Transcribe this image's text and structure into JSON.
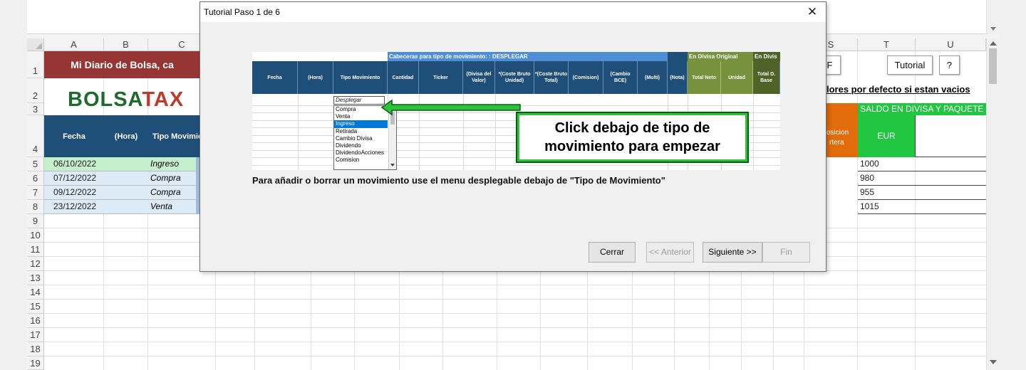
{
  "dialog": {
    "title": "Tutorial Paso 1 de 6",
    "close_glyph": "✕",
    "instruction": "Para añadir o borrar un movimiento use el menu desplegable debajo de \"Tipo de Movimiento\"",
    "callout": "Click debajo de tipo de movimiento para empezar",
    "buttons": {
      "cerrar": "Cerrar",
      "anterior": "<< Anterior",
      "siguiente": "Siguiente >>",
      "fin": "Fin"
    },
    "screenshot": {
      "band_desplegar": "Cabeceras para tipo de movimiento: : DESPLEGAR",
      "band_divisa": "En Divisa Original",
      "band_divis": "En Divis",
      "headers": [
        "Fecha",
        "(Hora)",
        "Tipo Movimiento",
        "Cantidad",
        "Ticker",
        "(Divisa del Valor)",
        "*(Coste Bruto Unidad)",
        "*(Coste Bruto Total)",
        "(Comision)",
        "(Cambio BCE)",
        "(Multi)",
        "(Nota)",
        "Total Neto",
        "Unidad",
        "Total D. Base"
      ],
      "dropdown_value": "Desplegar",
      "dropdown_items": [
        "Compra",
        "Venta",
        "Ingreso",
        "Retirada",
        "Cambio Divisa",
        "Dividendo",
        "DividendoAcciones",
        "Comision"
      ]
    }
  },
  "sheet": {
    "columns": [
      "A",
      "B",
      "C",
      "S",
      "T",
      "U"
    ],
    "row_numbers": [
      "1",
      "2",
      "3",
      "4",
      "5",
      "6",
      "7",
      "8",
      "9",
      "10",
      "11",
      "12",
      "13",
      "14",
      "15",
      "16",
      "17",
      "18",
      "19"
    ],
    "title_band": "Mi Diario de Bolsa, ca",
    "logo_part1": "BOLSA",
    "logo_part2": "TAX",
    "header_fecha": "Fecha",
    "header_hora": "(Hora)",
    "header_tipo": "Tipo Movimien",
    "rows": [
      {
        "fecha": "06/10/2022",
        "tipo": "Ingreso",
        "saldo": "1000"
      },
      {
        "fecha": "07/12/2022",
        "tipo": "Compra",
        "saldo": "980"
      },
      {
        "fecha": "09/12/2022",
        "tipo": "Compra",
        "saldo": "955"
      },
      {
        "fecha": "23/12/2022",
        "tipo": "Venta",
        "saldo": "1015"
      }
    ],
    "btn_f": "F",
    "btn_tutorial": "Tutorial",
    "btn_help": "?",
    "defaults_text": "lores por defecto si estan vacios",
    "saldo_header": "SALDO EN DIVISA Y PAQUETE",
    "posicion_line1": "osicion",
    "posicion_line2": "rtera",
    "eur": "EUR"
  }
}
